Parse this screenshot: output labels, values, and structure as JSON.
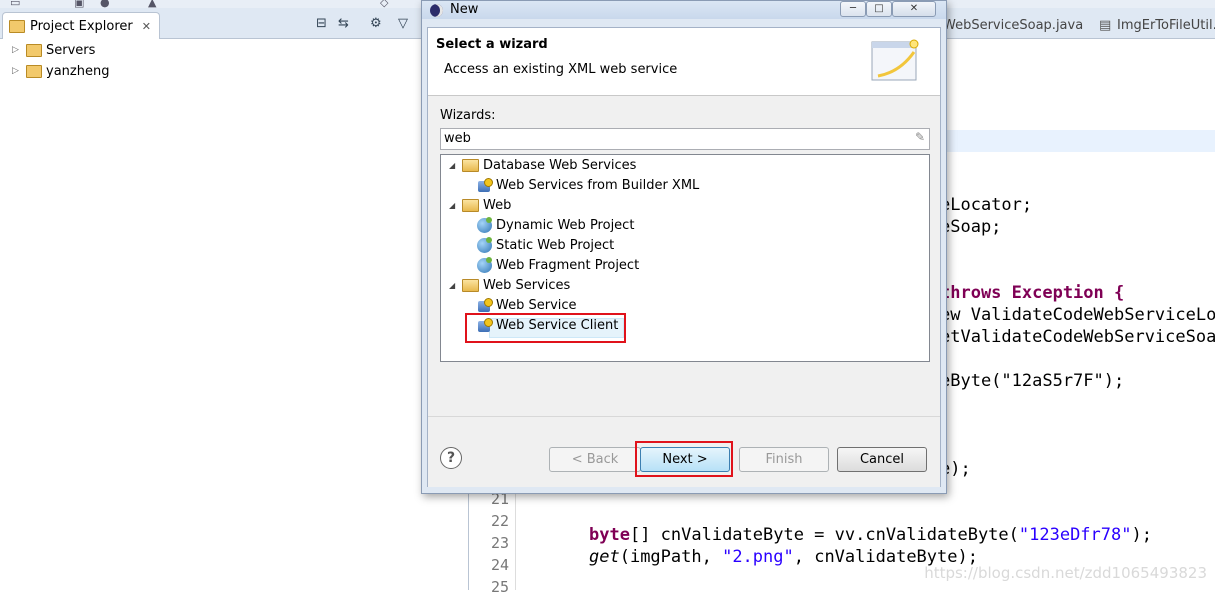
{
  "project_explorer": {
    "title": "Project Explorer",
    "items": [
      {
        "label": "Servers"
      },
      {
        "label": "yanzheng"
      }
    ]
  },
  "editor": {
    "tabs": [
      "WebServiceSoap.java",
      "ImgErToFileUtil.ja"
    ],
    "code_fragments": [
      {
        "text": "eLocator;"
      },
      {
        "text": "eSoap;"
      },
      {
        "text": "throws Exception {"
      },
      {
        "text": "ew ValidateCodeWebServiceLoc"
      },
      {
        "text": "etValidateCodeWebServiceSoap"
      },
      {
        "text": "eByte(\"12aS5r7F\");"
      },
      {
        "text": "e);"
      }
    ],
    "line_numbers": [
      "21",
      "22",
      "23",
      "24",
      "25"
    ],
    "line23": {
      "kw": "byte",
      "rest": "[] cnValidateByte = vv.cnValidateByte(",
      "str": "\"123eDfr78\"",
      "end": ");"
    },
    "line24": {
      "fn": "get",
      "a": "(imgPath, ",
      "str": "\"2.png\"",
      "end": ", cnValidateByte);"
    },
    "watermark": "https://blog.csdn.net/zdd1065493823"
  },
  "dialog": {
    "title": "New",
    "banner_title": "Select a wizard",
    "banner_desc": "Access an existing XML web service",
    "wizards_label": "Wizards:",
    "filter_value": "web",
    "tree": [
      {
        "label": "Database Web Services",
        "type": "folder"
      },
      {
        "label": "Web Services from Builder XML",
        "type": "item"
      },
      {
        "label": "Web",
        "type": "folder"
      },
      {
        "label": "Dynamic Web Project",
        "type": "item"
      },
      {
        "label": "Static Web Project",
        "type": "item"
      },
      {
        "label": "Web Fragment Project",
        "type": "item"
      },
      {
        "label": "Web Services",
        "type": "folder"
      },
      {
        "label": "Web Service",
        "type": "item"
      },
      {
        "label": "Web Service Client",
        "type": "item",
        "selected": true
      }
    ],
    "buttons": {
      "back": "< Back",
      "next": "Next >",
      "finish": "Finish",
      "cancel": "Cancel",
      "help": "?"
    }
  },
  "colors": {
    "highlight_red": "#e0121b",
    "keyword": "#7f0055",
    "string": "#2a00ff"
  }
}
